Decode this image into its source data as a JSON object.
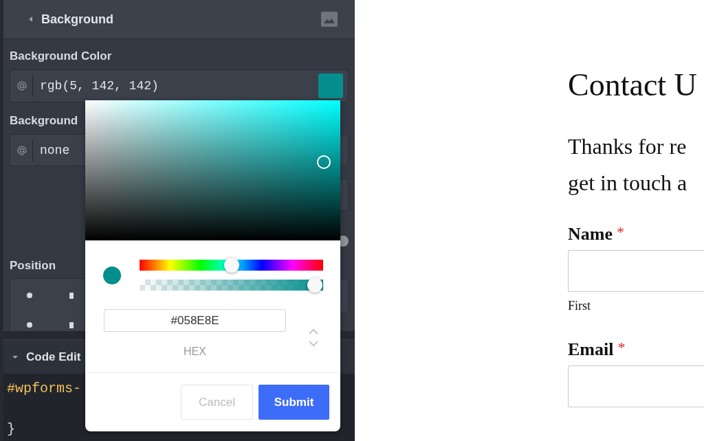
{
  "sidebar": {
    "header": {
      "title": "Background"
    },
    "fields": [
      {
        "kind": "color",
        "label": "Background Color",
        "value": "rgb(5, 142, 142)"
      },
      {
        "kind": "text",
        "label": "Background",
        "value": "none"
      },
      {
        "kind": "blank"
      },
      {
        "kind": "slider",
        "level": 1
      },
      {
        "kind": "position",
        "label": "Position"
      }
    ]
  },
  "code_editor": {
    "title": "Code Edit",
    "expanded": true,
    "lines": [
      {
        "kind": "selector",
        "text": "#wpforms-"
      },
      {
        "kind": "brace",
        "text": "}"
      }
    ]
  },
  "color_picker": {
    "value": "#058E8E",
    "format": "HEX",
    "hue": {
      "level": 0.5
    },
    "alpha": {
      "level": 1
    },
    "buttons": [
      {
        "kind": "secondary",
        "label": "Cancel"
      },
      {
        "kind": "primary",
        "label": "Submit"
      }
    ]
  },
  "page": {
    "title": "Contact U",
    "intro_lines": [
      "Thanks for re",
      "get in touch a"
    ],
    "fields": [
      {
        "label": "Name",
        "required_mark": "*",
        "sublabel": "First"
      },
      {
        "label": "Email",
        "required_mark": "*"
      }
    ]
  }
}
